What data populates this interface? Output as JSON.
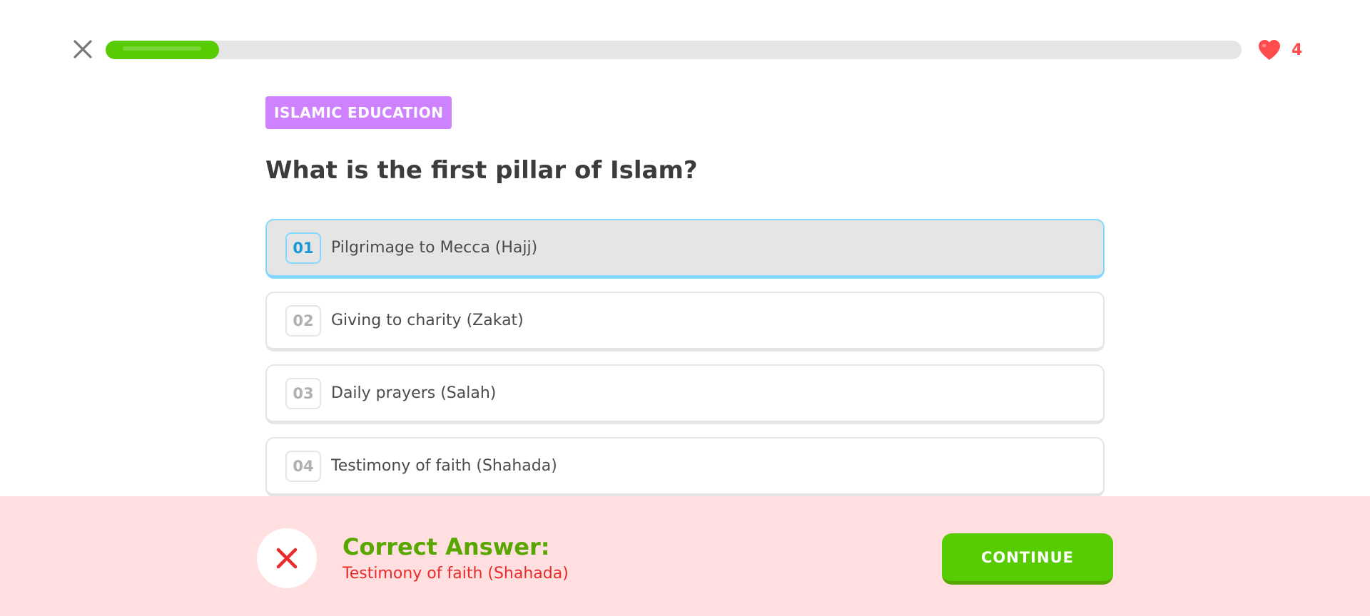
{
  "header": {
    "close_icon": "close-icon",
    "progress": 0.1,
    "hearts_icon": "heart-icon",
    "hearts_count": "4"
  },
  "lesson": {
    "category": "ISLAMIC EDUCATION",
    "question": "What is the first pillar of Islam?",
    "selected_index": 0,
    "options": [
      {
        "number": "01",
        "label": "Pilgrimage to Mecca (Hajj)"
      },
      {
        "number": "02",
        "label": "Giving to charity (Zakat)"
      },
      {
        "number": "03",
        "label": "Daily prayers (Salah)"
      },
      {
        "number": "04",
        "label": "Testimony of faith (Shahada)"
      }
    ]
  },
  "feedback": {
    "status_icon": "incorrect-x-icon",
    "title": "Correct Answer:",
    "answer": "Testimony of faith (Shahada)",
    "continue_label": "CONTINUE"
  },
  "colors": {
    "progress_green": "#58cc02",
    "badge_purple": "#ce82ff",
    "selected_blue": "#84d8ff",
    "feedback_bg": "#ffdfe0",
    "error_red": "#ea2b2b",
    "success_green": "#58a700"
  }
}
